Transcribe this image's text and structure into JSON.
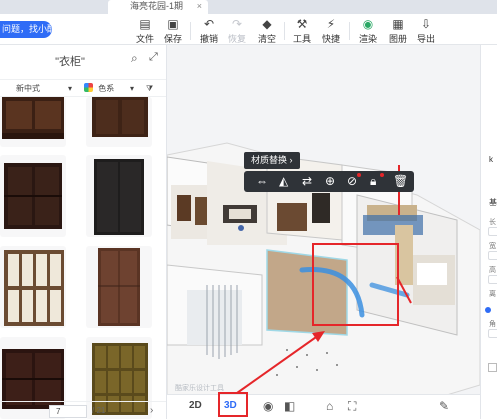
{
  "tab": {
    "title": "海亮花园-1期",
    "close": "×"
  },
  "help_button": "问题，找小酷",
  "toolbar": {
    "file": "文件",
    "save": "保存",
    "undo": "撤销",
    "redo": "恢复",
    "clear": "清空",
    "tools": "工具",
    "shortcut": "快捷",
    "render": "渲染",
    "drawing": "图册",
    "export": "导出"
  },
  "panel": {
    "title": "\"衣柜\"",
    "filter_style": "新中式",
    "filter_color": "色系"
  },
  "pager": {
    "current": "7",
    "total": "/ 21"
  },
  "float": {
    "label": "材质替换 ›"
  },
  "view": {
    "mode_2d": "2D",
    "mode_3d": "3D",
    "watermark": "酷家乐设计工具"
  },
  "right_panel": {
    "title": "k",
    "basic": "基",
    "fields": [
      "长",
      "宽",
      "高",
      "离"
    ],
    "angle": "角"
  },
  "colors": {
    "accent": "#2f6cf6",
    "annotation": "#e5262a",
    "toolbar_dark": "#2f3338"
  },
  "icons": [
    "file-icon",
    "save-icon",
    "undo-icon",
    "redo-icon",
    "clear-icon",
    "tools-icon",
    "shortcut-icon",
    "render-icon",
    "drawing-icon",
    "export-icon",
    "search-icon",
    "expand-icon",
    "eye-icon",
    "cube-icon",
    "camera-icon",
    "screen-icon",
    "pen-icon"
  ]
}
